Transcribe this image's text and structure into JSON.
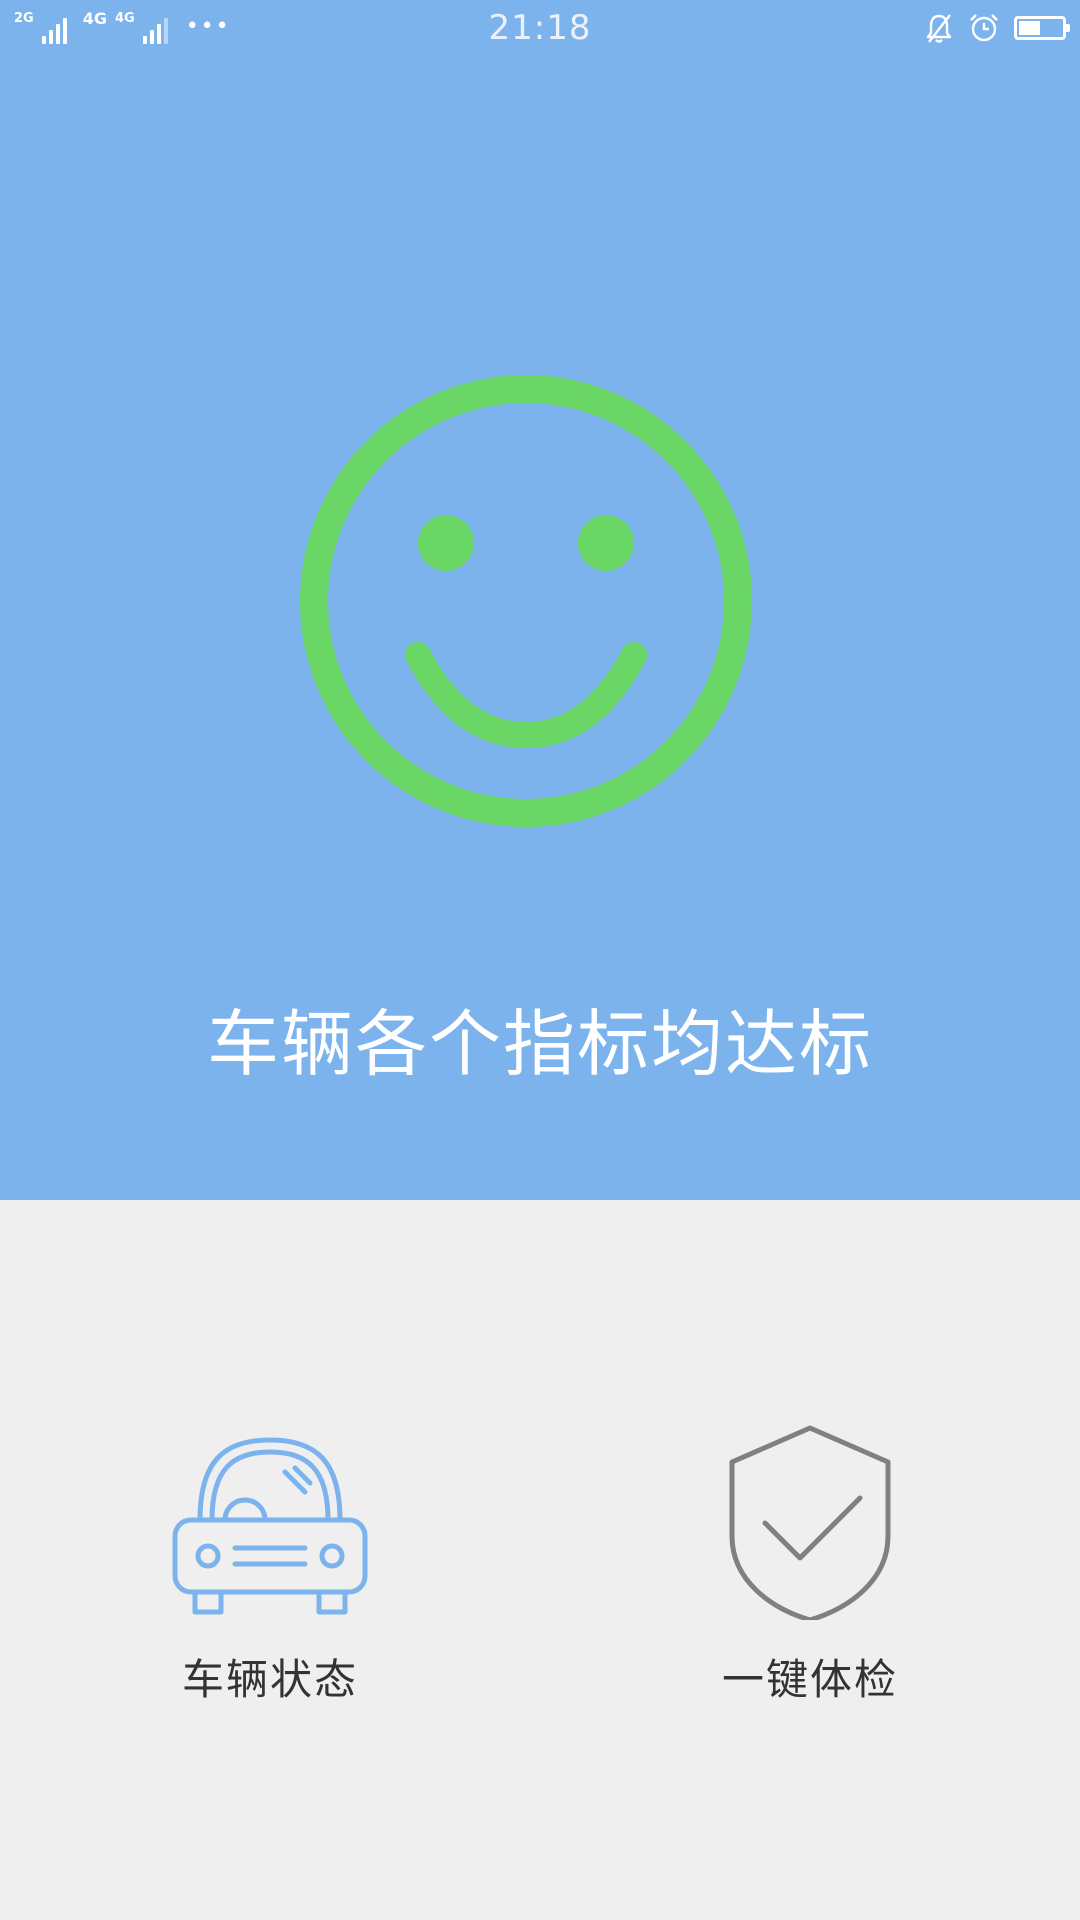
{
  "status_bar": {
    "network_1": "2G",
    "network_2": "4G",
    "network_3": "4G",
    "more_dots": "•••",
    "time": "21:18",
    "icons": [
      "mute-bell-icon",
      "alarm-clock-icon",
      "battery-icon"
    ],
    "battery_level": 0.45
  },
  "top_panel": {
    "background_color": "#7cb3ec",
    "status_icon": "smiley-face-icon",
    "status_icon_color": "#6bd766",
    "message": "车辆各个指标均达标"
  },
  "actions": [
    {
      "label": "车辆状态",
      "icon": "car-icon",
      "icon_color": "#7cb3ec"
    },
    {
      "label": "一键体检",
      "icon": "shield-check-icon",
      "icon_color": "#808080"
    }
  ]
}
